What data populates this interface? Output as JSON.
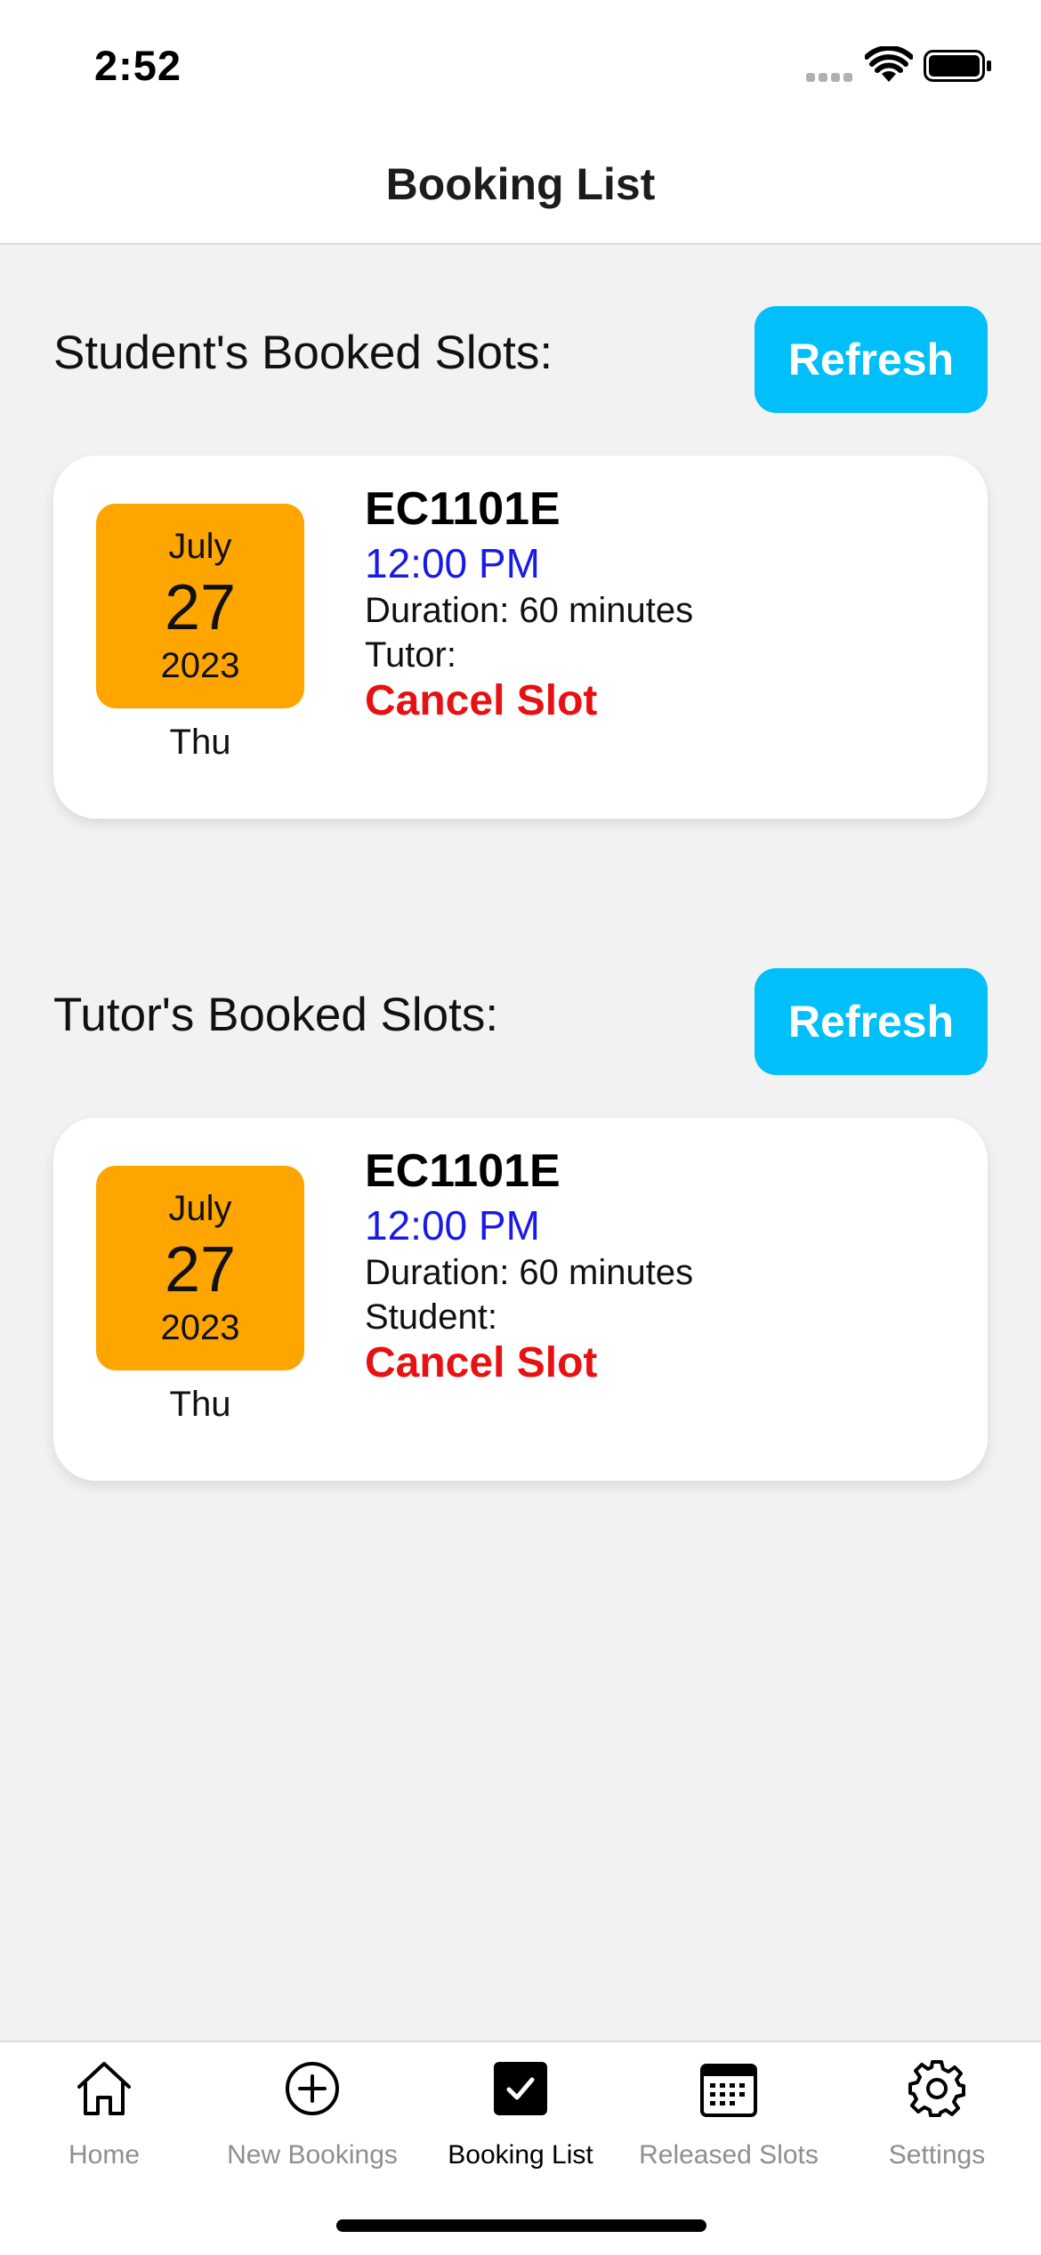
{
  "status_bar": {
    "time": "2:52",
    "icons": [
      "signal-dots-icon",
      "wifi-icon",
      "battery-icon"
    ]
  },
  "header": {
    "title": "Booking List"
  },
  "student_section": {
    "title": "Student's Booked Slots:",
    "refresh_label": "Refresh",
    "slots": [
      {
        "month": "July",
        "day": "27",
        "year": "2023",
        "weekday": "Thu",
        "course": "EC1101E",
        "time": "12:00 PM",
        "duration": "Duration: 60 minutes",
        "person": "Tutor:",
        "cancel_label": "Cancel Slot"
      }
    ]
  },
  "tutor_section": {
    "title": "Tutor's Booked Slots:",
    "refresh_label": "Refresh",
    "slots": [
      {
        "month": "July",
        "day": "27",
        "year": "2023",
        "weekday": "Thu",
        "course": "EC1101E",
        "time": "12:00 PM",
        "duration": "Duration: 60 minutes",
        "person": "Student:",
        "cancel_label": "Cancel Slot"
      }
    ]
  },
  "tab_bar": {
    "active": "Booking List",
    "items": [
      {
        "label": "Home",
        "icon": "home-icon"
      },
      {
        "label": "New Bookings",
        "icon": "plus-circle-icon"
      },
      {
        "label": "Booking List",
        "icon": "checkbox-icon"
      },
      {
        "label": "Released Slots",
        "icon": "calendar-icon"
      },
      {
        "label": "Settings",
        "icon": "gear-icon"
      }
    ]
  },
  "colors": {
    "refresh_button": "#00bff9",
    "date_badge": "#ffa500",
    "slot_time": "#1a1ae6",
    "cancel_text": "#e81010",
    "background": "#f2f2f2"
  }
}
